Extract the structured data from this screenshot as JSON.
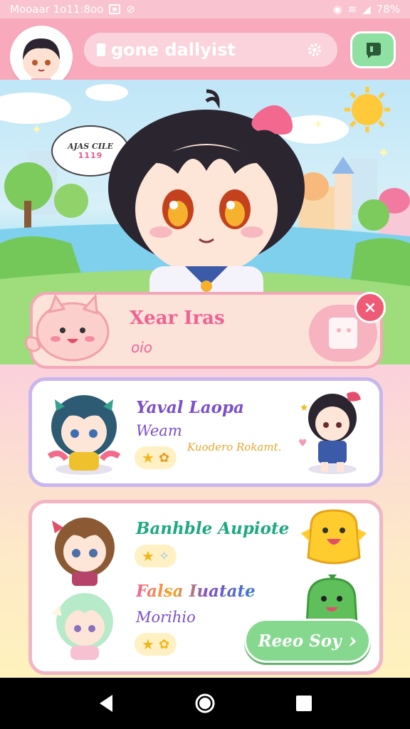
{
  "status_bar": {
    "time": "Mooaar 1o11:8oo",
    "battery": "78%"
  },
  "header": {
    "title": "gone dallyist"
  },
  "scene": {
    "speech_line1": "AJAS CILE",
    "speech_line2": "1119"
  },
  "profile_card": {
    "name": "Xear Iras",
    "subtitle": "oio",
    "close_glyph": "×"
  },
  "card2": {
    "name": "Yaval Laopa",
    "role": "Weam",
    "tagline": "Kuodero Rokamt."
  },
  "card3": {
    "item1_name": "Banhble Aupiote",
    "item2_name": "Falsa Iuatate",
    "item2_role": "Morihio",
    "cta_label": "Reeo Soy",
    "cta_arrow": "›"
  },
  "colors": {
    "brand_pink": "#f8a9bb",
    "accent_green": "#86d88f",
    "accent_purple": "#7b4fc9",
    "accent_teal": "#1ea980"
  }
}
